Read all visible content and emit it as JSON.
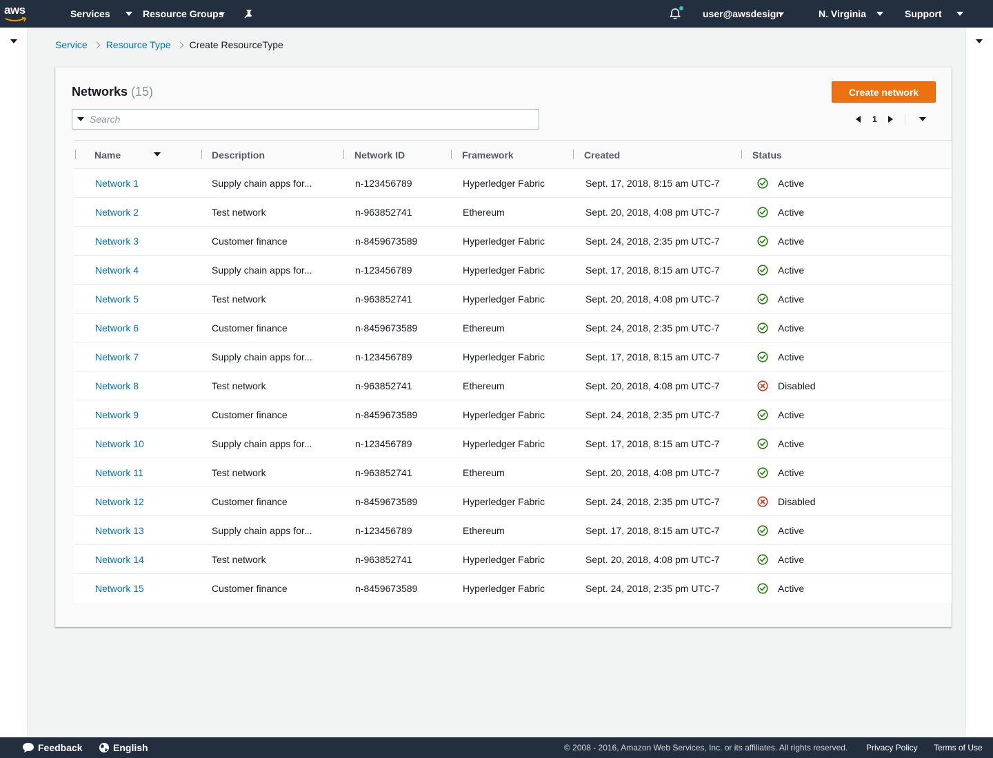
{
  "nav": {
    "logo": "aws",
    "services": "Services",
    "resource_groups": "Resource Groups",
    "user": "user@awsdesign",
    "region": "N. Virginia",
    "support": "Support"
  },
  "breadcrumb": {
    "items": [
      "Service",
      "Resource Type"
    ],
    "current": "Create ResourceType"
  },
  "card": {
    "title": "Networks",
    "count": "(15)",
    "create_button": "Create network",
    "search_placeholder": "Search",
    "page": "1"
  },
  "table": {
    "columns": [
      "Name",
      "Description",
      "Network ID",
      "Framework",
      "Created",
      "Status"
    ],
    "rows": [
      {
        "name": "Network 1",
        "description": "Supply chain apps for...",
        "id": "n-123456789",
        "framework": "Hyperledger Fabric",
        "created": "Sept. 17, 2018, 8:15 am UTC-7",
        "status": "Active"
      },
      {
        "name": "Network 2",
        "description": "Test network",
        "id": "n-963852741",
        "framework": "Ethereum",
        "created": "Sept. 20, 2018, 4:08 pm UTC-7",
        "status": "Active"
      },
      {
        "name": "Network 3",
        "description": "Customer finance",
        "id": "n-8459673589",
        "framework": "Hyperledger Fabric",
        "created": "Sept. 24, 2018, 2:35 pm UTC-7",
        "status": "Active"
      },
      {
        "name": "Network 4",
        "description": "Supply chain apps for...",
        "id": "n-123456789",
        "framework": "Hyperledger Fabric",
        "created": "Sept. 17, 2018, 8:15 am UTC-7",
        "status": "Active"
      },
      {
        "name": "Network 5",
        "description": "Test network",
        "id": "n-963852741",
        "framework": "Hyperledger Fabric",
        "created": "Sept. 20, 2018, 4:08 pm UTC-7",
        "status": "Active"
      },
      {
        "name": "Network 6",
        "description": "Customer finance",
        "id": "n-8459673589",
        "framework": "Ethereum",
        "created": "Sept. 24, 2018, 2:35 pm UTC-7",
        "status": "Active"
      },
      {
        "name": "Network 7",
        "description": "Supply chain apps for...",
        "id": "n-123456789",
        "framework": "Hyperledger Fabric",
        "created": "Sept. 17, 2018, 8:15 am UTC-7",
        "status": "Active"
      },
      {
        "name": "Network 8",
        "description": "Test network",
        "id": "n-963852741",
        "framework": "Ethereum",
        "created": "Sept. 20, 2018, 4:08 pm UTC-7",
        "status": "Disabled"
      },
      {
        "name": "Network 9",
        "description": "Customer finance",
        "id": "n-8459673589",
        "framework": "Hyperledger Fabric",
        "created": "Sept. 24, 2018, 2:35 pm UTC-7",
        "status": "Active"
      },
      {
        "name": "Network 10",
        "description": "Supply chain apps for...",
        "id": "n-123456789",
        "framework": "Hyperledger Fabric",
        "created": "Sept. 17, 2018, 8:15 am UTC-7",
        "status": "Active"
      },
      {
        "name": "Network 11",
        "description": "Test network",
        "id": "n-963852741",
        "framework": "Ethereum",
        "created": "Sept. 20, 2018, 4:08 pm UTC-7",
        "status": "Active"
      },
      {
        "name": "Network 12",
        "description": "Customer finance",
        "id": "n-8459673589",
        "framework": "Hyperledger Fabric",
        "created": "Sept. 24, 2018, 2:35 pm UTC-7",
        "status": "Disabled"
      },
      {
        "name": "Network 13",
        "description": "Supply chain apps for...",
        "id": "n-123456789",
        "framework": "Ethereum",
        "created": "Sept. 17, 2018, 8:15 am UTC-7",
        "status": "Active"
      },
      {
        "name": "Network 14",
        "description": "Test network",
        "id": "n-963852741",
        "framework": "Hyperledger Fabric",
        "created": "Sept. 20, 2018, 4:08 pm UTC-7",
        "status": "Active"
      },
      {
        "name": "Network 15",
        "description": "Customer finance",
        "id": "n-8459673589",
        "framework": "Hyperledger Fabric",
        "created": "Sept. 24, 2018, 2:35 pm UTC-7",
        "status": "Active"
      }
    ]
  },
  "footer": {
    "feedback": "Feedback",
    "language": "English",
    "copyright": "© 2008 - 2016, Amazon Web Services, Inc. or its affiliates. All rights reserved.",
    "privacy": "Privacy Policy",
    "terms": "Terms of Use"
  },
  "colors": {
    "nav_bg": "#232f3e",
    "primary_button": "#ec7211",
    "link": "#0073bb",
    "status_active": "#1d8102",
    "status_disabled": "#d13212"
  }
}
